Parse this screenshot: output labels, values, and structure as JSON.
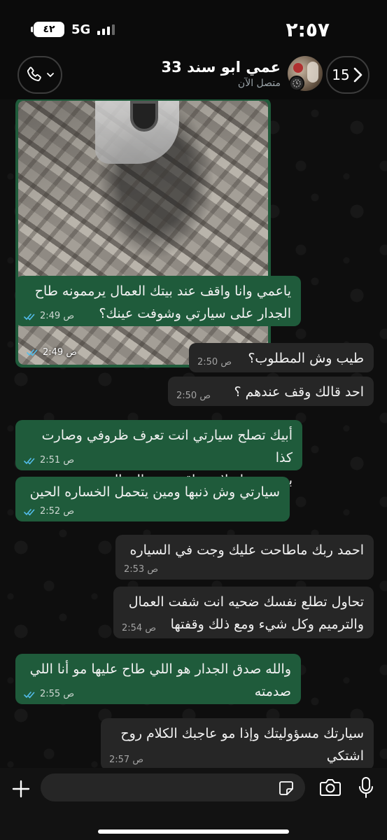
{
  "status_bar": {
    "time": "٢:٥٧",
    "battery": "٤٢",
    "network": "5G"
  },
  "header": {
    "back_count": "15",
    "contact_name": "عمي ابو سند 33",
    "contact_status": "متصل الآن",
    "icons": {
      "back": "chevron-left-icon",
      "call": "phone-icon",
      "call_menu": "chevron-down-icon"
    }
  },
  "messages": [
    {
      "type": "image",
      "direction": "out",
      "time": "2:49 ص",
      "read": true
    },
    {
      "type": "text",
      "direction": "out",
      "lines": [
        "ياعمي وانا واقف عند بيتك العمال يرممونه طاح",
        "الجدار على سيارتي وشوفت عينك؟"
      ],
      "time": "2:49 ص",
      "read": true
    },
    {
      "type": "text",
      "direction": "in",
      "lines": [
        "طيب وش المطلوب؟"
      ],
      "time": "2:50 ص"
    },
    {
      "type": "text",
      "direction": "in",
      "lines": [
        "احد قالك وقف عندهم ؟"
      ],
      "time": "2:50 ص"
    },
    {
      "type": "text",
      "direction": "out",
      "lines": [
        "أبيك تصلح سيارتي انت تعرف ظروفي وصارت كذا",
        "بسبب بيتك لاني واقف عند العمال"
      ],
      "time": "2:51 ص",
      "read": true
    },
    {
      "type": "text",
      "direction": "out",
      "lines": [
        "سيارتي وش ذنبها ومين يتحمل الخساره الحين"
      ],
      "time": "2:52 ص",
      "read": true
    },
    {
      "type": "text",
      "direction": "in",
      "lines": [
        "احمد ربك ماطاحت عليك وجت في السياره"
      ],
      "time": "2:53 ص"
    },
    {
      "type": "text",
      "direction": "in",
      "lines": [
        "تحاول تطلع نفسك ضحيه انت شفت العمال",
        "والترميم وكل شيء ومع ذلك وقفتها"
      ],
      "time": "2:54 ص"
    },
    {
      "type": "text",
      "direction": "out",
      "lines": [
        "والله صدق الجدار هو اللي طاح عليها مو أنا اللي",
        "صدمته"
      ],
      "time": "2:55 ص",
      "read": true
    },
    {
      "type": "text",
      "direction": "in",
      "lines": [
        "سيارتك مسؤوليتك وإذا مو عاجبك الكلام روح",
        "اشتكي"
      ],
      "time": "2:57 ص"
    }
  ],
  "composer": {
    "input_value": "",
    "icons": [
      "plus-icon",
      "sticker-icon",
      "camera-icon",
      "microphone-icon"
    ]
  },
  "colors": {
    "outgoing_bubble": "#1f5b3b",
    "incoming_bubble": "#262626",
    "read_tick": "#53bdeb",
    "background": "#0b0b0b"
  }
}
